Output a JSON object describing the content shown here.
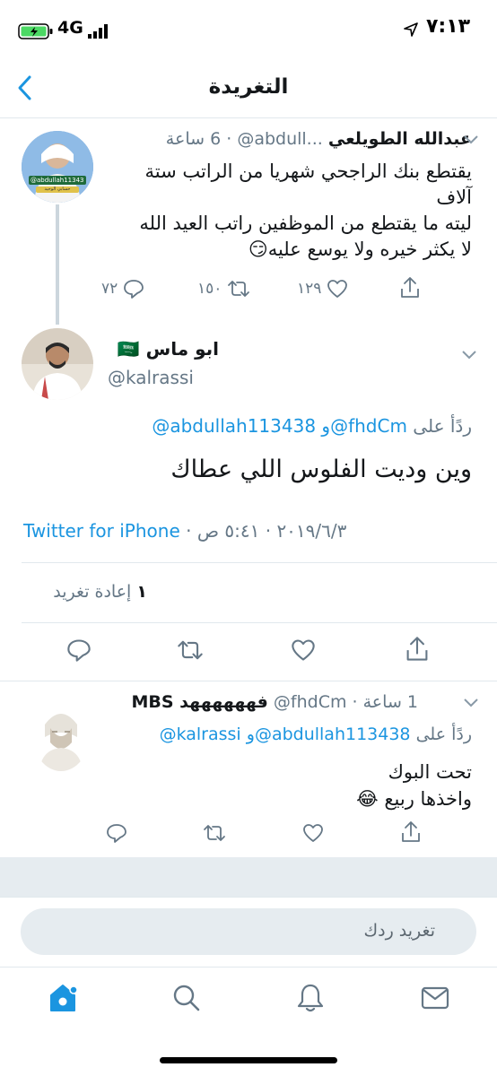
{
  "status_bar": {
    "time": "٧:١٣",
    "network": "4G"
  },
  "header": {
    "title": "التغريدة"
  },
  "parent_tweet": {
    "name": "عبدالله الطويلعي",
    "handle": "@abdull...",
    "time": "6 ساعة",
    "separator": "·",
    "text_lines": [
      "يقتطع بنك الراجحي شهريا من الراتب ستة",
      "آلاف",
      "ليته ما يقتطع من الموظفين راتب العيد الله",
      "لا يكثر خيره ولا يوسع عليه😏"
    ],
    "avatar_label": "@abdullah113438",
    "avatar_sub": "حسابي الوحيد",
    "replies": "٧٢",
    "retweets": "١٥٠",
    "likes": "١٢٩"
  },
  "main_tweet": {
    "name": "ابو ماس",
    "flag": "🇸🇦",
    "handle": "@kalrassi",
    "reply_to_prefix": "ردًأ على",
    "reply_to_users": "@abdullah113438 و@fhdCm",
    "text": "وين وديت الفلوس اللي عطاك",
    "time": "٥:٤١ ص",
    "date": "٢٠١٩/٦/٣",
    "source": "Twitter for iPhone",
    "retweet_count_num": "١",
    "retweet_count_label": "إعادة تغريد"
  },
  "reply_tweet": {
    "name": "فههههههد MBS",
    "handle": "@fhdCm",
    "time": "1 ساعة",
    "reply_to_prefix": "ردًأ على",
    "reply_to_users": "@kalrassi و@abdullah113438",
    "text_lines": [
      "تحت البوك",
      "واخذها ربيع 😂"
    ]
  },
  "compose": {
    "placeholder": "تغريد ردك"
  },
  "colors": {
    "accent": "#1b95e0",
    "muted": "#657786",
    "border": "#e1e8ed"
  },
  "icons": [
    "back-chevron-icon",
    "reply-icon",
    "retweet-icon",
    "like-icon",
    "share-icon",
    "home-icon",
    "search-icon",
    "notifications-icon",
    "messages-icon"
  ]
}
